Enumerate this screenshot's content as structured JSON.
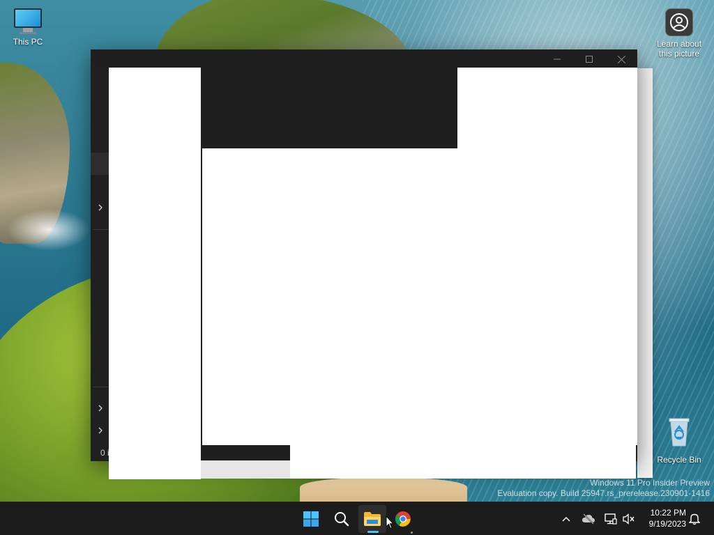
{
  "desktop": {
    "icons": [
      {
        "label": "This PC",
        "icon": "computer-icon"
      },
      {
        "label": "Learn about\nthis picture",
        "icon": "learn-about-picture-icon"
      },
      {
        "label": "Recycle Bin",
        "icon": "recycle-bin-icon"
      }
    ],
    "watermark": {
      "line1": "Windows 11 Pro Insider Preview",
      "line2": "Evaluation copy. Build 25947.rs_prerelease.230901-1416"
    }
  },
  "explorer": {
    "status_text": "0 i",
    "window_controls": [
      "minimize-icon",
      "maximize-icon",
      "close-icon"
    ],
    "chevron_icon": "chevron-right-icon"
  },
  "taskbar": {
    "pinned": [
      {
        "name": "Start",
        "icon": "windows-logo-icon"
      },
      {
        "name": "Search",
        "icon": "search-icon"
      },
      {
        "name": "File Explorer",
        "icon": "folder-icon",
        "active": true
      },
      {
        "name": "Google Chrome",
        "icon": "chrome-icon"
      }
    ],
    "tray": {
      "icons": [
        "chevron-up-icon",
        "cloud-off-icon",
        "network-icon",
        "volume-muted-icon",
        "notification-bell-icon"
      ],
      "time": "10:22 PM",
      "date": "9/19/2023"
    },
    "accent_color": "#4cc2ff"
  }
}
